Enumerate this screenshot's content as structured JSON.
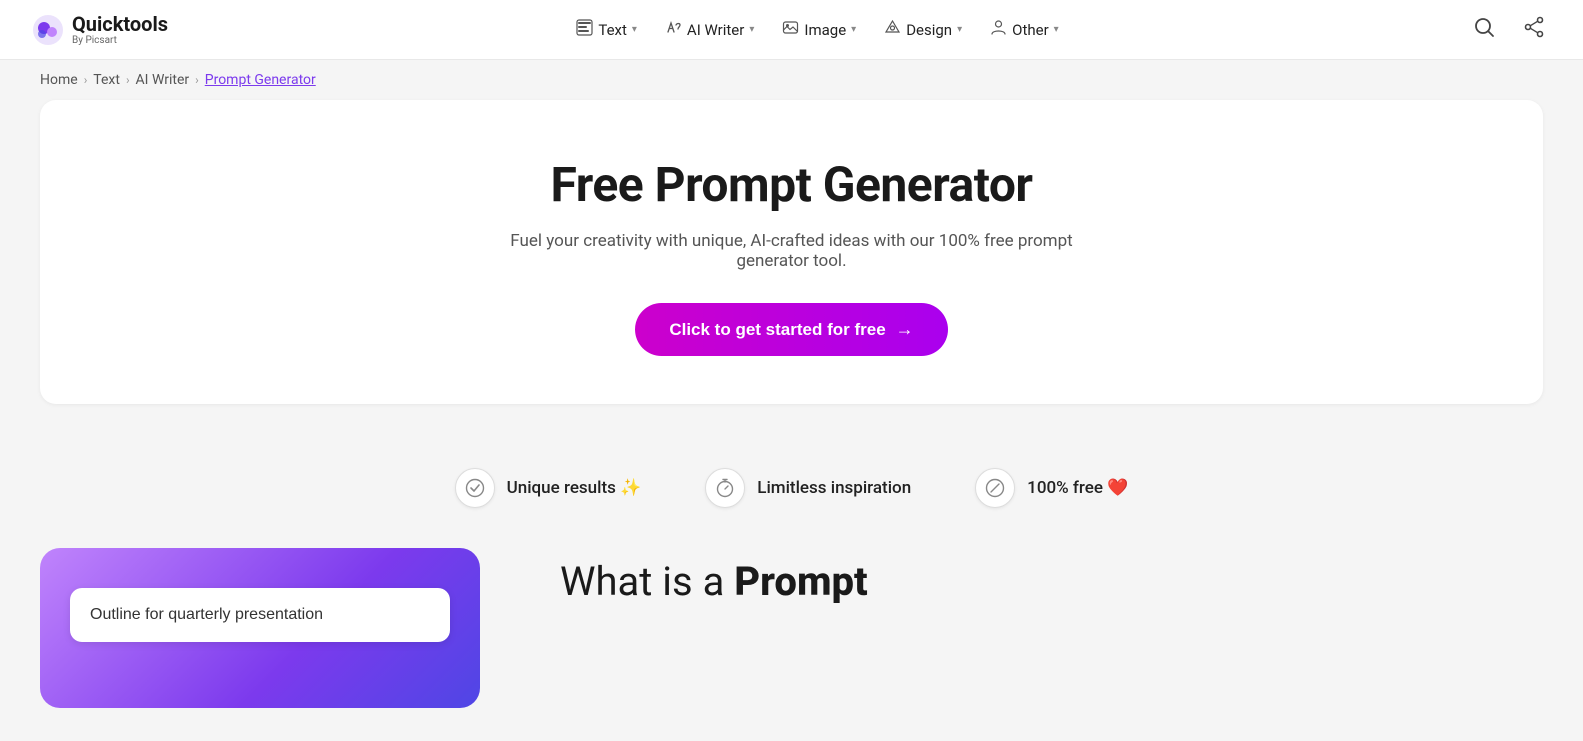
{
  "logo": {
    "main": "Quicktools",
    "sub": "By Picsart"
  },
  "nav": {
    "items": [
      {
        "id": "text",
        "icon": "⬜",
        "label": "Text",
        "has_chevron": true
      },
      {
        "id": "ai-writer",
        "icon": "✏️",
        "label": "AI Writer",
        "has_chevron": true
      },
      {
        "id": "image",
        "icon": "🖼️",
        "label": "Image",
        "has_chevron": true
      },
      {
        "id": "design",
        "icon": "✂️",
        "label": "Design",
        "has_chevron": true
      },
      {
        "id": "other",
        "icon": "👤",
        "label": "Other",
        "has_chevron": true
      }
    ],
    "search_aria": "Search",
    "share_aria": "Share"
  },
  "breadcrumb": {
    "items": [
      {
        "label": "Home",
        "href": "#"
      },
      {
        "label": "Text",
        "href": "#"
      },
      {
        "label": "AI Writer",
        "href": "#"
      },
      {
        "label": "Prompt Generator",
        "href": "#",
        "current": true
      }
    ]
  },
  "hero": {
    "title": "Free Prompt Generator",
    "subtitle": "Fuel your creativity with unique, AI-crafted ideas with our 100% free prompt generator tool.",
    "cta_label": "Click to get started for free",
    "cta_arrow": "→"
  },
  "features": [
    {
      "id": "unique",
      "icon": "✓",
      "label": "Unique results",
      "emoji": "✨"
    },
    {
      "id": "limitless",
      "icon": "⏱",
      "label": "Limitless inspiration",
      "emoji": ""
    },
    {
      "id": "free",
      "icon": "◎",
      "label": "100% free",
      "emoji": "❤️"
    }
  ],
  "demo": {
    "input_value": "Outline for quarterly presentation",
    "input_placeholder": "Outline for quarterly presentation"
  },
  "what_is": {
    "prefix": "What is a ",
    "bold": "Prompt"
  }
}
